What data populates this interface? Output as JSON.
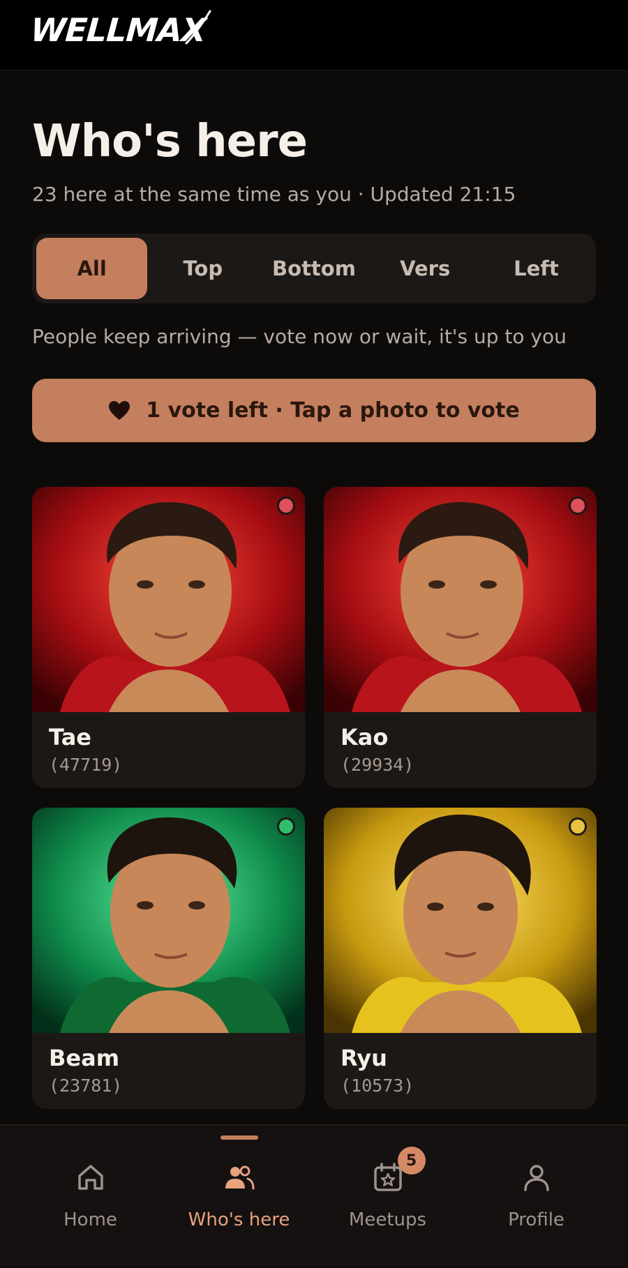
{
  "app": {
    "logo_text": "WELLMAX"
  },
  "page": {
    "title": "Who's here",
    "subtitle": "23 here at the same time as you · Updated 21:15",
    "hint": "People keep arriving — vote now or wait, it's up to you"
  },
  "tabs": [
    {
      "label": "All",
      "active": true
    },
    {
      "label": "Top",
      "active": false
    },
    {
      "label": "Bottom",
      "active": false
    },
    {
      "label": "Vers",
      "active": false
    },
    {
      "label": "Left",
      "active": false
    }
  ],
  "vote_bar": {
    "label": "1 vote left · Tap a photo to vote",
    "icon": "heart-icon"
  },
  "people": [
    {
      "name": "Tae",
      "id": "(47719)",
      "status_color": "#e0505a",
      "theme": "red"
    },
    {
      "name": "Kao",
      "id": "(29934)",
      "status_color": "#e0505a",
      "theme": "red"
    },
    {
      "name": "Beam",
      "id": "(23781)",
      "status_color": "#2fbf6a",
      "theme": "green"
    },
    {
      "name": "Ryu",
      "id": "(10573)",
      "status_color": "#e8c13e",
      "theme": "yellow"
    }
  ],
  "nav": [
    {
      "label": "Home",
      "icon": "home-icon",
      "active": false
    },
    {
      "label": "Who's here",
      "icon": "people-icon",
      "active": true
    },
    {
      "label": "Meetups",
      "icon": "calendar-star-icon",
      "active": false,
      "badge": "5"
    },
    {
      "label": "Profile",
      "icon": "user-icon",
      "active": false
    }
  ],
  "colors": {
    "accent": "#c47f5e",
    "background": "#0d0b0a",
    "card": "#1c1816"
  }
}
